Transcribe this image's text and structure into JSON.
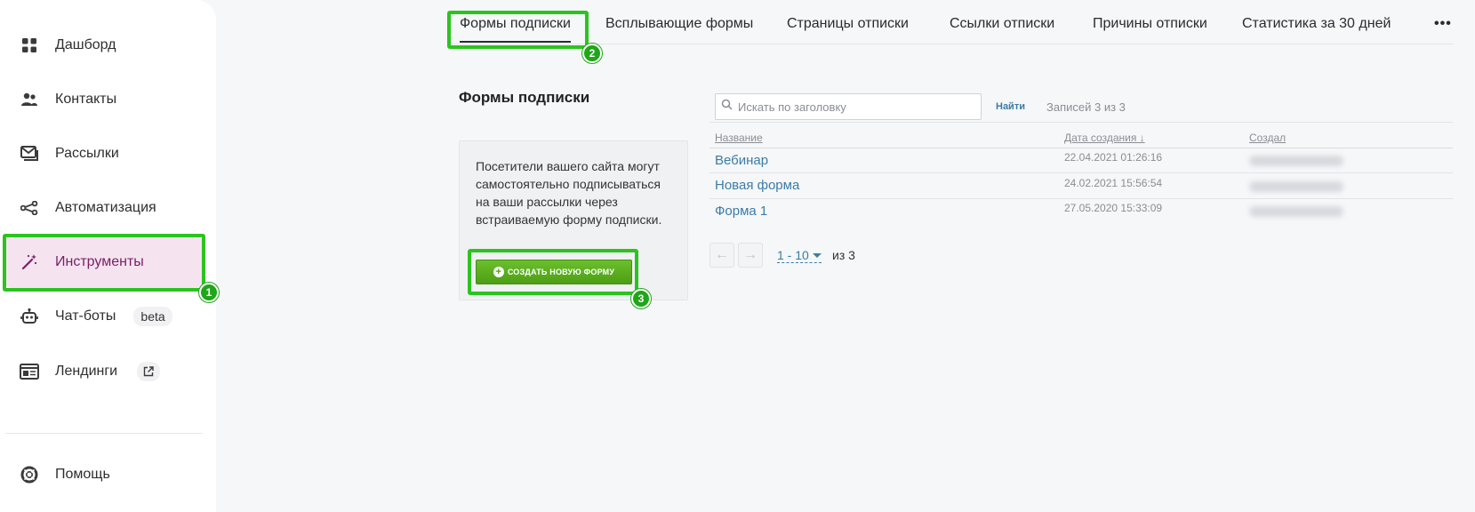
{
  "sidebar": {
    "items": [
      {
        "label": "Дашборд",
        "icon": "grid-icon"
      },
      {
        "label": "Контакты",
        "icon": "users-icon"
      },
      {
        "label": "Рассылки",
        "icon": "mail-icon"
      },
      {
        "label": "Автоматизация",
        "icon": "flow-icon"
      },
      {
        "label": "Инструменты",
        "icon": "magic-wand-icon"
      },
      {
        "label": "Чат-боты",
        "icon": "robot-icon",
        "badge": "beta"
      },
      {
        "label": "Лендинги",
        "icon": "landing-icon"
      },
      {
        "label": "Помощь",
        "icon": "help-lifebuoy-icon"
      }
    ],
    "active_color": "#7b1e64"
  },
  "tabs": {
    "items": [
      "Формы подписки",
      "Всплывающие формы",
      "Страницы отписки",
      "Ссылки отписки",
      "Причины отписки",
      "Статистика за 30 дней"
    ],
    "more": "•••"
  },
  "markers": [
    "1",
    "2",
    "3"
  ],
  "main": {
    "title": "Формы подписки",
    "info_text": "Посетители вашего сайта могут самостоятельно подписываться на ваши рассылки через встраиваемую форму подписки.",
    "create_button": "СОЗДАТЬ НОВУЮ ФОРМУ",
    "search": {
      "placeholder": "Искать по заголовку",
      "value": ""
    },
    "find_label": "Найти",
    "records_count": "Записей 3 из 3",
    "table": {
      "headers": [
        "Название",
        "Дата создания ↓",
        "Создал"
      ],
      "rows": [
        {
          "name": "Вебинар",
          "date": "22.04.2021 01:26:16"
        },
        {
          "name": "Новая форма",
          "date": "24.02.2021 15:56:54"
        },
        {
          "name": "Форма 1",
          "date": "27.05.2020 15:33:09"
        }
      ]
    },
    "pagination": {
      "range": "1 - 10",
      "total": "из 3"
    }
  },
  "colors": {
    "highlight": "#2bc41e",
    "link": "#3a7ca8",
    "button": "#5aaf1e"
  }
}
